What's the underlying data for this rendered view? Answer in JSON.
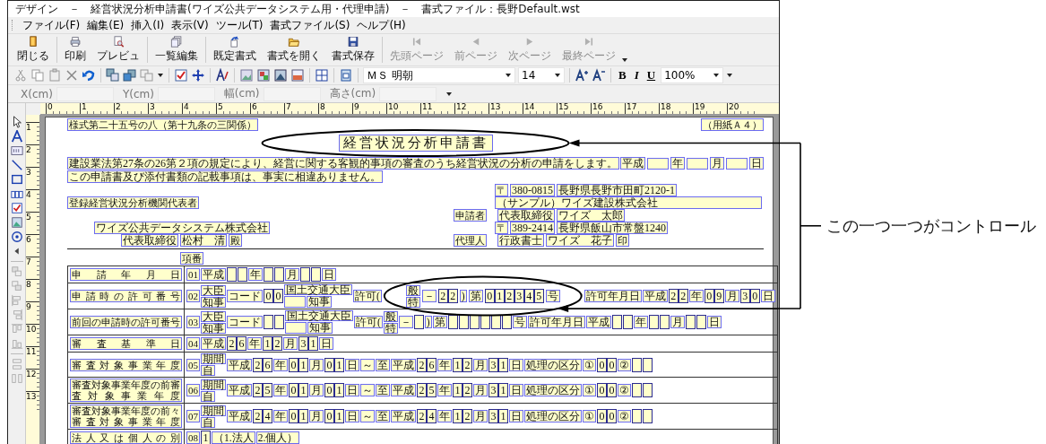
{
  "window": {
    "title": "デザイン　－　経営状況分析申請書(ワイズ公共データシステム用・代理申請)　－　書式ファイル：長野Default.wst"
  },
  "menu": [
    "ファイル(F)",
    "編集(E)",
    "挿入(I)",
    "表示(V)",
    "ツール(T)",
    "書式ファイル(S)",
    "ヘルプ(H)"
  ],
  "toolbar": [
    {
      "label": "閉じる",
      "disabled": false
    },
    {
      "label": "印刷",
      "disabled": false
    },
    {
      "label": "プレビュ",
      "disabled": false
    },
    {
      "label": "一覧編集",
      "disabled": false
    },
    {
      "label": "既定書式",
      "disabled": false
    },
    {
      "label": "書式を開く",
      "disabled": false
    },
    {
      "label": "書式保存",
      "disabled": false
    },
    {
      "label": "先頭ページ",
      "disabled": true
    },
    {
      "label": "前ページ",
      "disabled": true
    },
    {
      "label": "次ページ",
      "disabled": true
    },
    {
      "label": "最終ページ",
      "disabled": true
    }
  ],
  "format_toolbar": {
    "font": "ＭＳ 明朝",
    "size": "14",
    "bold": "B",
    "italic": "I",
    "underline": "U",
    "zoom": "100%"
  },
  "position_bar": [
    "X(cm)",
    "Y(cm)",
    "幅(cm)",
    "高さ(cm)"
  ],
  "rulers": {
    "horizontal": [
      "0",
      "1",
      "2",
      "3",
      "4",
      "5",
      "6",
      "7",
      "8",
      "9",
      "10",
      "11",
      "12",
      "13",
      "14",
      "15",
      "16",
      "17",
      "18",
      "19",
      "20"
    ],
    "vertical": [
      "1",
      "2",
      "3",
      "4",
      "5",
      "6",
      "7",
      "8",
      "9",
      "10",
      "11",
      "12",
      "13"
    ]
  },
  "form": {
    "form_number": "様式第二十五号の八（第十九条の三関係）",
    "paper": "（用紙Ａ４）",
    "title": "経営状況分析申請書",
    "title_circled": true,
    "declaration": [
      "建設業法第27条の26第２項の規定により、経営に関する客観的事項の審査のうち経営状況の分析の申請をします。",
      "この申請書及び添付書類の記載事項は、事実に相違ありません。"
    ],
    "date": [
      {
        "kind": "label",
        "text": "平成"
      },
      {
        "kind": "field"
      },
      {
        "kind": "label",
        "text": "年"
      },
      {
        "kind": "field"
      },
      {
        "kind": "label",
        "text": "月"
      },
      {
        "kind": "field"
      },
      {
        "kind": "label",
        "text": "日"
      }
    ],
    "addressee": {
      "title": "登録経営状況分析機関代表者",
      "company": "ワイズ公共データシステム株式会社",
      "position": "代表取締役",
      "name": "松村　清",
      "honorific": "殿"
    },
    "applicant": {
      "postal_mark": "〒",
      "postal_code": "380-0815",
      "address": "長野県長野市田町2120-1",
      "company": "（サンプル）ワイズ建設株式会社",
      "role": "申請者",
      "position": "代表取締役",
      "name": "ワイズ　太郎"
    },
    "agent": {
      "postal_mark": "〒",
      "postal_code": "389-2414",
      "address": "長野県飯山市常盤1240",
      "role": "代理人",
      "position": "行政書士",
      "name": "ワイズ　花子",
      "seal": "印"
    },
    "item_header": "項番",
    "rows": [
      {
        "label": "申請年月日",
        "cells": [
          {
            "kind": "number",
            "text": "01"
          },
          {
            "kind": "label",
            "text": "平成"
          },
          {
            "kind": "blank"
          },
          {
            "kind": "blank"
          },
          {
            "kind": "label",
            "text": "年"
          },
          {
            "kind": "blank"
          },
          {
            "kind": "blank"
          },
          {
            "kind": "label",
            "text": "月"
          },
          {
            "kind": "blank"
          },
          {
            "kind": "blank"
          },
          {
            "kind": "label",
            "text": "日"
          }
        ]
      },
      {
        "label": "申請時の許可番号",
        "cells": [
          {
            "kind": "number",
            "text": "02"
          },
          {
            "kind": "stack",
            "lines": [
              [
                {
                  "kind": "label",
                  "text": "大臣"
                }
              ],
              [
                {
                  "kind": "label",
                  "text": "知事"
                }
              ]
            ]
          },
          {
            "kind": "label",
            "text": "コード"
          },
          {
            "kind": "digits",
            "digits": [
              "0",
              "0"
            ]
          },
          {
            "kind": "stack",
            "lines": [
              [
                {
                  "kind": "label",
                  "text": "国土交通大臣"
                }
              ],
              [
                {
                  "kind": "field"
                },
                {
                  "kind": "label",
                  "text": "知事"
                }
              ]
            ]
          },
          {
            "kind": "label",
            "text": "許可("
          },
          {
            "kind": "group",
            "circled": true,
            "cells": [
              {
                "kind": "stack",
                "lines": [
                  [
                    {
                      "kind": "label",
                      "text": "般"
                    }
                  ],
                  [
                    {
                      "kind": "label",
                      "text": "特"
                    }
                  ]
                ]
              },
              {
                "kind": "label",
                "text": "－"
              },
              {
                "kind": "digits",
                "digits": [
                  "2",
                  "2"
                ]
              },
              {
                "kind": "label",
                "text": ")"
              },
              {
                "kind": "label",
                "text": "第"
              },
              {
                "kind": "digits",
                "digits": [
                  "0",
                  "1",
                  "2",
                  "3",
                  "4",
                  "5"
                ]
              },
              {
                "kind": "label",
                "text": "号"
              }
            ]
          },
          {
            "kind": "label",
            "text": "許可年月日"
          },
          {
            "kind": "label",
            "text": "平成"
          },
          {
            "kind": "digits",
            "digits": [
              "2",
              "2"
            ]
          },
          {
            "kind": "label",
            "text": "年"
          },
          {
            "kind": "digits",
            "digits": [
              "0",
              "9"
            ]
          },
          {
            "kind": "label",
            "text": "月"
          },
          {
            "kind": "digits",
            "digits": [
              "3",
              "0"
            ]
          },
          {
            "kind": "label",
            "text": "日"
          }
        ]
      },
      {
        "label": "前回の申請時の許可番号",
        "cells": [
          {
            "kind": "number",
            "text": "03"
          },
          {
            "kind": "stack",
            "lines": [
              [
                {
                  "kind": "label",
                  "text": "大臣"
                }
              ],
              [
                {
                  "kind": "label",
                  "text": "知事"
                }
              ]
            ]
          },
          {
            "kind": "label",
            "text": "コード"
          },
          {
            "kind": "blank"
          },
          {
            "kind": "blank"
          },
          {
            "kind": "stack",
            "lines": [
              [
                {
                  "kind": "label",
                  "text": "国土交通大臣"
                }
              ],
              [
                {
                  "kind": "field"
                },
                {
                  "kind": "label",
                  "text": "知事"
                }
              ]
            ]
          },
          {
            "kind": "label",
            "text": "許可("
          },
          {
            "kind": "stack",
            "lines": [
              [
                {
                  "kind": "label",
                  "text": "般"
                }
              ],
              [
                {
                  "kind": "label",
                  "text": "特"
                }
              ]
            ]
          },
          {
            "kind": "label",
            "text": "－"
          },
          {
            "kind": "blank"
          },
          {
            "kind": "label",
            "text": ")"
          },
          {
            "kind": "label",
            "text": "第"
          },
          {
            "kind": "blank"
          },
          {
            "kind": "blank"
          },
          {
            "kind": "blank"
          },
          {
            "kind": "blank"
          },
          {
            "kind": "blank"
          },
          {
            "kind": "blank"
          },
          {
            "kind": "label",
            "text": "号"
          },
          {
            "kind": "label",
            "text": "許可年月日"
          },
          {
            "kind": "label",
            "text": "平成"
          },
          {
            "kind": "blank"
          },
          {
            "kind": "blank"
          },
          {
            "kind": "label",
            "text": "年"
          },
          {
            "kind": "blank"
          },
          {
            "kind": "blank"
          },
          {
            "kind": "label",
            "text": "月"
          },
          {
            "kind": "blank"
          },
          {
            "kind": "blank"
          },
          {
            "kind": "label",
            "text": "日"
          }
        ]
      },
      {
        "label": "審査基準日",
        "cells": [
          {
            "kind": "number",
            "text": "04"
          },
          {
            "kind": "label",
            "text": "平成"
          },
          {
            "kind": "digits",
            "digits": [
              "2",
              "6"
            ]
          },
          {
            "kind": "label",
            "text": "年"
          },
          {
            "kind": "digits",
            "digits": [
              "1",
              "2"
            ]
          },
          {
            "kind": "label",
            "text": "月"
          },
          {
            "kind": "digits",
            "digits": [
              "3",
              "1"
            ]
          },
          {
            "kind": "label",
            "text": "日"
          }
        ]
      },
      {
        "label": "審査対象事業年度",
        "cells": [
          {
            "kind": "number",
            "text": "05"
          },
          {
            "kind": "stack",
            "lines": [
              [
                {
                  "kind": "label",
                  "text": "期間"
                }
              ],
              [
                {
                  "kind": "label",
                  "text": "自"
                }
              ]
            ]
          },
          {
            "kind": "label",
            "text": "平成"
          },
          {
            "kind": "digits",
            "digits": [
              "2",
              "6"
            ]
          },
          {
            "kind": "label",
            "text": "年"
          },
          {
            "kind": "digits",
            "digits": [
              "0",
              "1"
            ]
          },
          {
            "kind": "label",
            "text": "月"
          },
          {
            "kind": "digits",
            "digits": [
              "0",
              "1"
            ]
          },
          {
            "kind": "label",
            "text": "日"
          },
          {
            "kind": "label",
            "text": "～"
          },
          {
            "kind": "label",
            "text": "至"
          },
          {
            "kind": "label",
            "text": "平成"
          },
          {
            "kind": "digits",
            "digits": [
              "2",
              "6"
            ]
          },
          {
            "kind": "label",
            "text": "年"
          },
          {
            "kind": "digits",
            "digits": [
              "1",
              "2"
            ]
          },
          {
            "kind": "label",
            "text": "月"
          },
          {
            "kind": "digits",
            "digits": [
              "3",
              "1"
            ]
          },
          {
            "kind": "label",
            "text": "日"
          },
          {
            "kind": "label",
            "text": "処理の区分"
          },
          {
            "kind": "label",
            "text": "①"
          },
          {
            "kind": "digits",
            "digits": [
              "0",
              "0"
            ]
          },
          {
            "kind": "label",
            "text": "②"
          },
          {
            "kind": "blank"
          },
          {
            "kind": "blank"
          }
        ]
      },
      {
        "label": "審査対象事業年度の前審査対象事業年度",
        "cells": [
          {
            "kind": "number",
            "text": "06"
          },
          {
            "kind": "stack",
            "lines": [
              [
                {
                  "kind": "label",
                  "text": "期間"
                }
              ],
              [
                {
                  "kind": "label",
                  "text": "自"
                }
              ]
            ]
          },
          {
            "kind": "label",
            "text": "平成"
          },
          {
            "kind": "digits",
            "digits": [
              "2",
              "5"
            ]
          },
          {
            "kind": "label",
            "text": "年"
          },
          {
            "kind": "digits",
            "digits": [
              "0",
              "1"
            ]
          },
          {
            "kind": "label",
            "text": "月"
          },
          {
            "kind": "digits",
            "digits": [
              "0",
              "1"
            ]
          },
          {
            "kind": "label",
            "text": "日"
          },
          {
            "kind": "label",
            "text": "～"
          },
          {
            "kind": "label",
            "text": "至"
          },
          {
            "kind": "label",
            "text": "平成"
          },
          {
            "kind": "digits",
            "digits": [
              "2",
              "5"
            ]
          },
          {
            "kind": "label",
            "text": "年"
          },
          {
            "kind": "digits",
            "digits": [
              "1",
              "2"
            ]
          },
          {
            "kind": "label",
            "text": "月"
          },
          {
            "kind": "digits",
            "digits": [
              "3",
              "1"
            ]
          },
          {
            "kind": "label",
            "text": "日"
          },
          {
            "kind": "label",
            "text": "処理の区分"
          },
          {
            "kind": "label",
            "text": "①"
          },
          {
            "kind": "digits",
            "digits": [
              "0",
              "0"
            ]
          },
          {
            "kind": "label",
            "text": "②"
          },
          {
            "kind": "blank"
          },
          {
            "kind": "blank"
          }
        ]
      },
      {
        "label": "審査対象事業年度の前々審査対象事業年度",
        "cells": [
          {
            "kind": "number",
            "text": "07"
          },
          {
            "kind": "stack",
            "lines": [
              [
                {
                  "kind": "label",
                  "text": "期間"
                }
              ],
              [
                {
                  "kind": "label",
                  "text": "自"
                }
              ]
            ]
          },
          {
            "kind": "label",
            "text": "平成"
          },
          {
            "kind": "digits",
            "digits": [
              "2",
              "4"
            ]
          },
          {
            "kind": "label",
            "text": "年"
          },
          {
            "kind": "digits",
            "digits": [
              "0",
              "1"
            ]
          },
          {
            "kind": "label",
            "text": "月"
          },
          {
            "kind": "digits",
            "digits": [
              "0",
              "1"
            ]
          },
          {
            "kind": "label",
            "text": "日"
          },
          {
            "kind": "label",
            "text": "～"
          },
          {
            "kind": "label",
            "text": "至"
          },
          {
            "kind": "label",
            "text": "平成"
          },
          {
            "kind": "digits",
            "digits": [
              "2",
              "4"
            ]
          },
          {
            "kind": "label",
            "text": "年"
          },
          {
            "kind": "digits",
            "digits": [
              "1",
              "2"
            ]
          },
          {
            "kind": "label",
            "text": "月"
          },
          {
            "kind": "digits",
            "digits": [
              "3",
              "1"
            ]
          },
          {
            "kind": "label",
            "text": "日"
          },
          {
            "kind": "label",
            "text": "処理の区分"
          },
          {
            "kind": "label",
            "text": "①"
          },
          {
            "kind": "digits",
            "digits": [
              "0",
              "0"
            ]
          },
          {
            "kind": "label",
            "text": "②"
          },
          {
            "kind": "blank"
          },
          {
            "kind": "blank"
          }
        ]
      },
      {
        "label": "法人又は個人の別",
        "cells": [
          {
            "kind": "number",
            "text": "08"
          },
          {
            "kind": "digits",
            "digits": [
              "1"
            ]
          },
          {
            "kind": "label",
            "text": "（1.法人"
          },
          {
            "kind": "label",
            "text": "2.個人）"
          }
        ]
      }
    ]
  },
  "annotation": {
    "text": "この一つ一つがコントロール"
  }
}
